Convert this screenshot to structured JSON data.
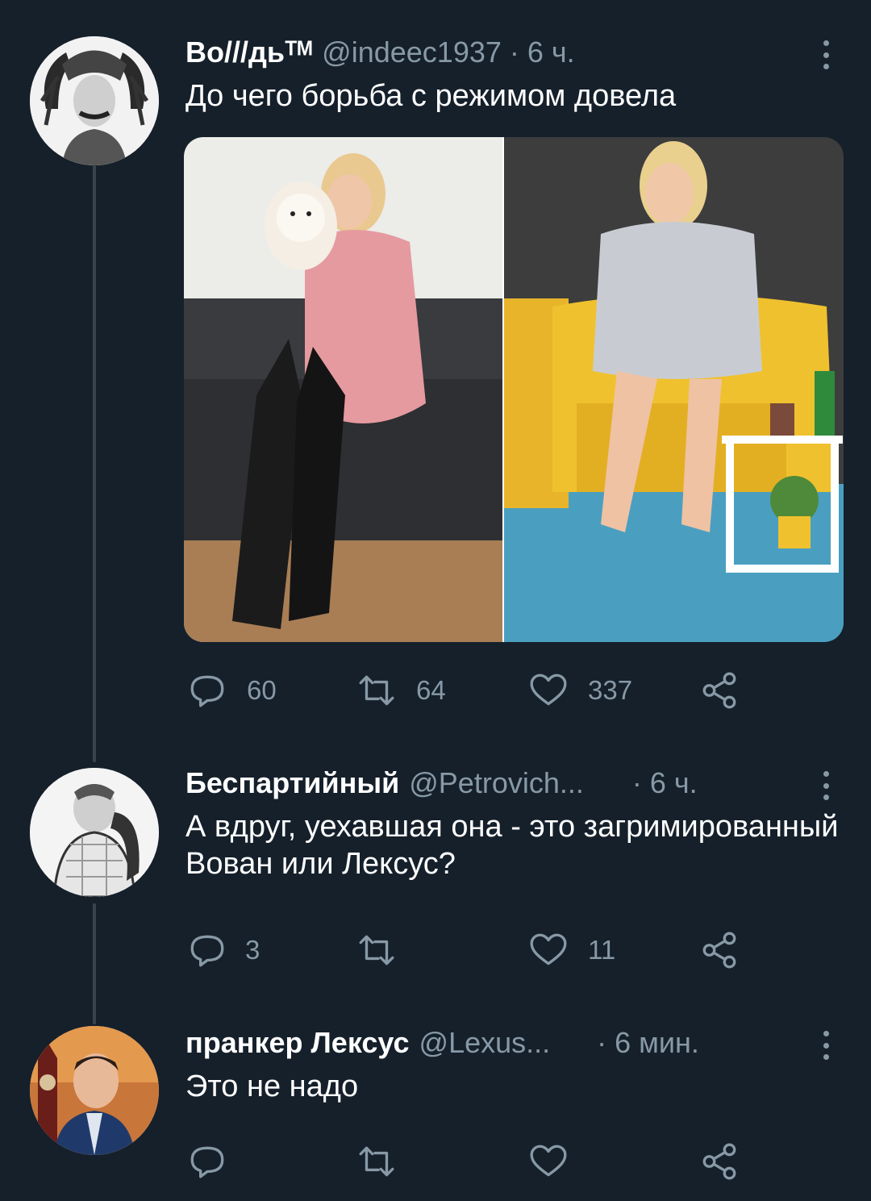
{
  "tweets": [
    {
      "display_name": "Во///дьᵀᴹ",
      "handle": "@indeec1937",
      "separator": "·",
      "time": "6 ч.",
      "text": "До чего борьба с режимом довела",
      "reply_count": "60",
      "retweet_count": "64",
      "like_count": "337",
      "share_count": ""
    },
    {
      "display_name": "Беспартийный",
      "handle": "@Petrovich...",
      "separator": "·",
      "time": "6 ч.",
      "text": "А вдруг, уехавшая она - это загримированный Вован или Лексус?",
      "reply_count": "3",
      "retweet_count": "",
      "like_count": "11",
      "share_count": ""
    },
    {
      "display_name": "пранкер Лексус",
      "handle": "@Lexus...",
      "separator": "·",
      "time": "6 мин.",
      "text": "Это не надо",
      "reply_count": "",
      "retweet_count": "",
      "like_count": "",
      "share_count": ""
    }
  ],
  "icons": {
    "reply": "reply-bubble-icon",
    "retweet": "retweet-icon",
    "like": "heart-icon",
    "share": "share-icon",
    "more": "more-vertical-icon"
  },
  "colors": {
    "background": "#15202b",
    "secondary_text": "#8899a6",
    "thread_line": "#38444d",
    "primary_text": "#ffffff"
  }
}
